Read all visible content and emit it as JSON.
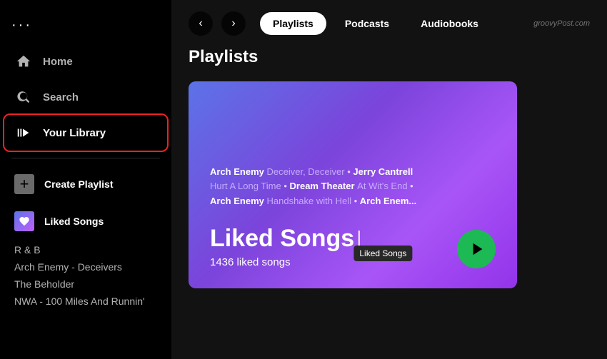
{
  "sidebar": {
    "dots": "···",
    "nav": [
      {
        "id": "home",
        "label": "Home",
        "icon": "home"
      },
      {
        "id": "search",
        "label": "Search",
        "icon": "search"
      },
      {
        "id": "your-library",
        "label": "Your Library",
        "icon": "library",
        "active": true
      }
    ],
    "actions": [
      {
        "id": "create-playlist",
        "label": "Create Playlist",
        "type": "create"
      },
      {
        "id": "liked-songs",
        "label": "Liked Songs",
        "type": "liked"
      }
    ],
    "playlists": [
      "R & B",
      "Arch Enemy - Deceivers",
      "The Beholder",
      "NWA - 100 Miles And Runnin'"
    ]
  },
  "topbar": {
    "back_label": "‹",
    "forward_label": "›",
    "tabs": [
      {
        "id": "playlists",
        "label": "Playlists",
        "active": true
      },
      {
        "id": "podcasts",
        "label": "Podcasts",
        "active": false
      },
      {
        "id": "audiobooks",
        "label": "Audiobooks",
        "active": false
      }
    ],
    "watermark": "groovyPost.com"
  },
  "main": {
    "section_title": "Playlists",
    "liked_card": {
      "track_line1_part1": "Arch Enemy ",
      "track_line1_part2": "Deceiver, Deceiver",
      "track_line1_part3": " • ",
      "track_line1_part4": "Jerry Cantrell",
      "track_line2_part1": "Hurt A Long Time",
      "track_line2_part2": " • ",
      "track_line2_part3": "Dream Theater ",
      "track_line2_part4": "At Wit's End",
      "track_line2_part5": " •",
      "track_line3_part1": "Arch Enemy ",
      "track_line3_part2": "Handshake with Hell",
      "track_line3_part3": " • ",
      "track_line3_part4": "Arch Enem...",
      "title": "Liked Songs",
      "count": "1436 liked songs",
      "play_label": "▶",
      "tooltip": "Liked Songs"
    }
  }
}
